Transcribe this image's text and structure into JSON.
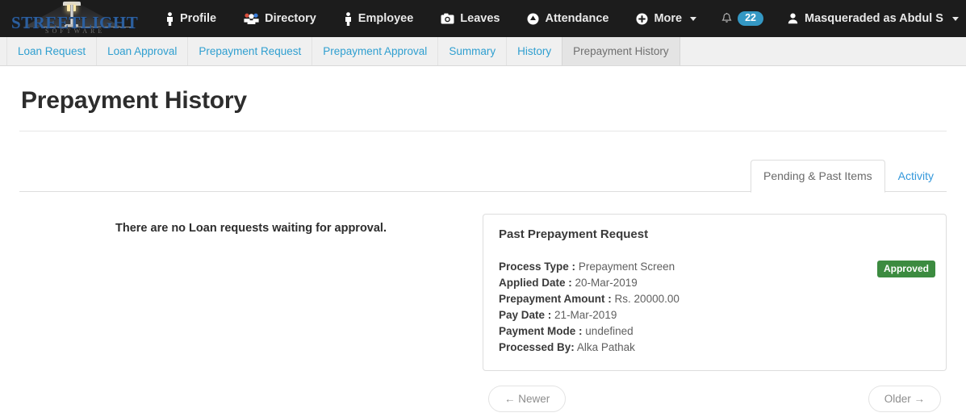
{
  "brand": {
    "word_street": "S",
    "wordmark_main": "STREET",
    "wordmark_light": "LIGHT",
    "subword": "SOFTWARE"
  },
  "navbar": {
    "items": [
      {
        "label": "Profile",
        "icon": "person-icon"
      },
      {
        "label": "Directory",
        "icon": "users-group-icon"
      },
      {
        "label": "Employee",
        "icon": "person-icon"
      },
      {
        "label": "Leaves",
        "icon": "camera-icon"
      },
      {
        "label": "Attendance",
        "icon": "circle-caret-icon"
      },
      {
        "label": "More",
        "icon": "plus-circle-icon",
        "caret": true
      }
    ],
    "notifications": {
      "icon": "bell-icon",
      "count": "22"
    },
    "user": {
      "icon": "user-avatar-icon",
      "label": "Masqueraded as Abdul S",
      "caret": true
    }
  },
  "subnav": {
    "items": [
      {
        "label": "Loan Request",
        "active": false
      },
      {
        "label": "Loan Approval",
        "active": false
      },
      {
        "label": "Prepayment Request",
        "active": false
      },
      {
        "label": "Prepayment Approval",
        "active": false
      },
      {
        "label": "Summary",
        "active": false
      },
      {
        "label": "History",
        "active": false
      },
      {
        "label": "Prepayment History",
        "active": true
      }
    ]
  },
  "page": {
    "title": "Prepayment History"
  },
  "tabs": [
    {
      "label": "Pending & Past Items",
      "active": true
    },
    {
      "label": "Activity",
      "active": false
    }
  ],
  "left_panel": {
    "empty_message": "There are no Loan requests waiting for approval."
  },
  "request_card": {
    "title": "Past Prepayment Request",
    "status": "Approved",
    "status_color": "#3c8b40",
    "fields": [
      {
        "label": "Process Type :",
        "value": "Prepayment Screen"
      },
      {
        "label": "Applied Date :",
        "value": "20-Mar-2019"
      },
      {
        "label": "Prepayment Amount :",
        "value": "Rs. 20000.00"
      },
      {
        "label": "Pay Date :",
        "value": "21-Mar-2019"
      },
      {
        "label": "Payment Mode :",
        "value": "undefined"
      },
      {
        "label": "Processed By:",
        "value": "Alka Pathak"
      }
    ]
  },
  "pager": {
    "newer": "← Newer",
    "older": "Older →"
  },
  "colors": {
    "navbar_bg": "#1c1c1c",
    "link_blue": "#3498db",
    "badge_blue": "#3498c4",
    "success_green": "#3c8b40"
  }
}
